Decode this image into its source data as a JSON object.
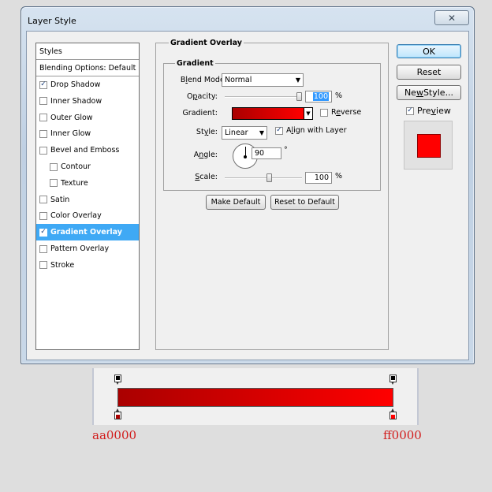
{
  "window": {
    "title": "Layer Style",
    "close_glyph": "✕"
  },
  "styles_list": {
    "header": "Styles",
    "blending": "Blending Options: Default",
    "items": [
      {
        "label": "Drop Shadow",
        "checked": true
      },
      {
        "label": "Inner Shadow",
        "checked": false
      },
      {
        "label": "Outer Glow",
        "checked": false
      },
      {
        "label": "Inner Glow",
        "checked": false
      },
      {
        "label": "Bevel and Emboss",
        "checked": false
      },
      {
        "label": "Contour",
        "checked": false
      },
      {
        "label": "Texture",
        "checked": false
      },
      {
        "label": "Satin",
        "checked": false
      },
      {
        "label": "Color Overlay",
        "checked": false
      },
      {
        "label": "Gradient Overlay",
        "checked": true,
        "selected": true
      },
      {
        "label": "Pattern Overlay",
        "checked": false
      },
      {
        "label": "Stroke",
        "checked": false
      }
    ]
  },
  "panel": {
    "title": "Gradient Overlay",
    "group_title": "Gradient",
    "blend_mode": {
      "label_pre": "B",
      "label_u": "l",
      "label_post": "end Mode:",
      "value": "Normal"
    },
    "opacity": {
      "label_pre": "O",
      "label_u": "p",
      "label_post": "acity:",
      "value": "100",
      "unit": "%",
      "level": 1.0
    },
    "gradient": {
      "label": "Gradient:",
      "start_color": "#aa0000",
      "end_color": "#ff0000"
    },
    "reverse": {
      "label_pre": "R",
      "label_u": "e",
      "label_post": "verse",
      "checked": false
    },
    "style": {
      "label_pre": "St",
      "label_u": "y",
      "label_post": "le:",
      "value": "Linear"
    },
    "align": {
      "label_pre": "A",
      "label_u": "l",
      "label_post": "ign with Layer",
      "checked": true
    },
    "angle": {
      "label_pre": "A",
      "label_u": "n",
      "label_post": "gle:",
      "value": "90",
      "unit": "°"
    },
    "scale": {
      "label_pre": "",
      "label_u": "S",
      "label_post": "cale:",
      "value": "100",
      "unit": "%",
      "level": 0.4
    },
    "make_default": "Make Default",
    "reset_default": "Reset to Default"
  },
  "buttons": {
    "ok": "OK",
    "reset": "Reset",
    "new_style_pre": "Ne",
    "new_style_u": "w",
    "new_style_post": " Style...",
    "preview": {
      "label_pre": "Pre",
      "label_u": "v",
      "label_post": "iew",
      "checked": true
    }
  },
  "gradient_editor": {
    "left_hex": "aa0000",
    "right_hex": "ff0000",
    "left_color": "#aa0000",
    "right_color": "#ff0000"
  }
}
